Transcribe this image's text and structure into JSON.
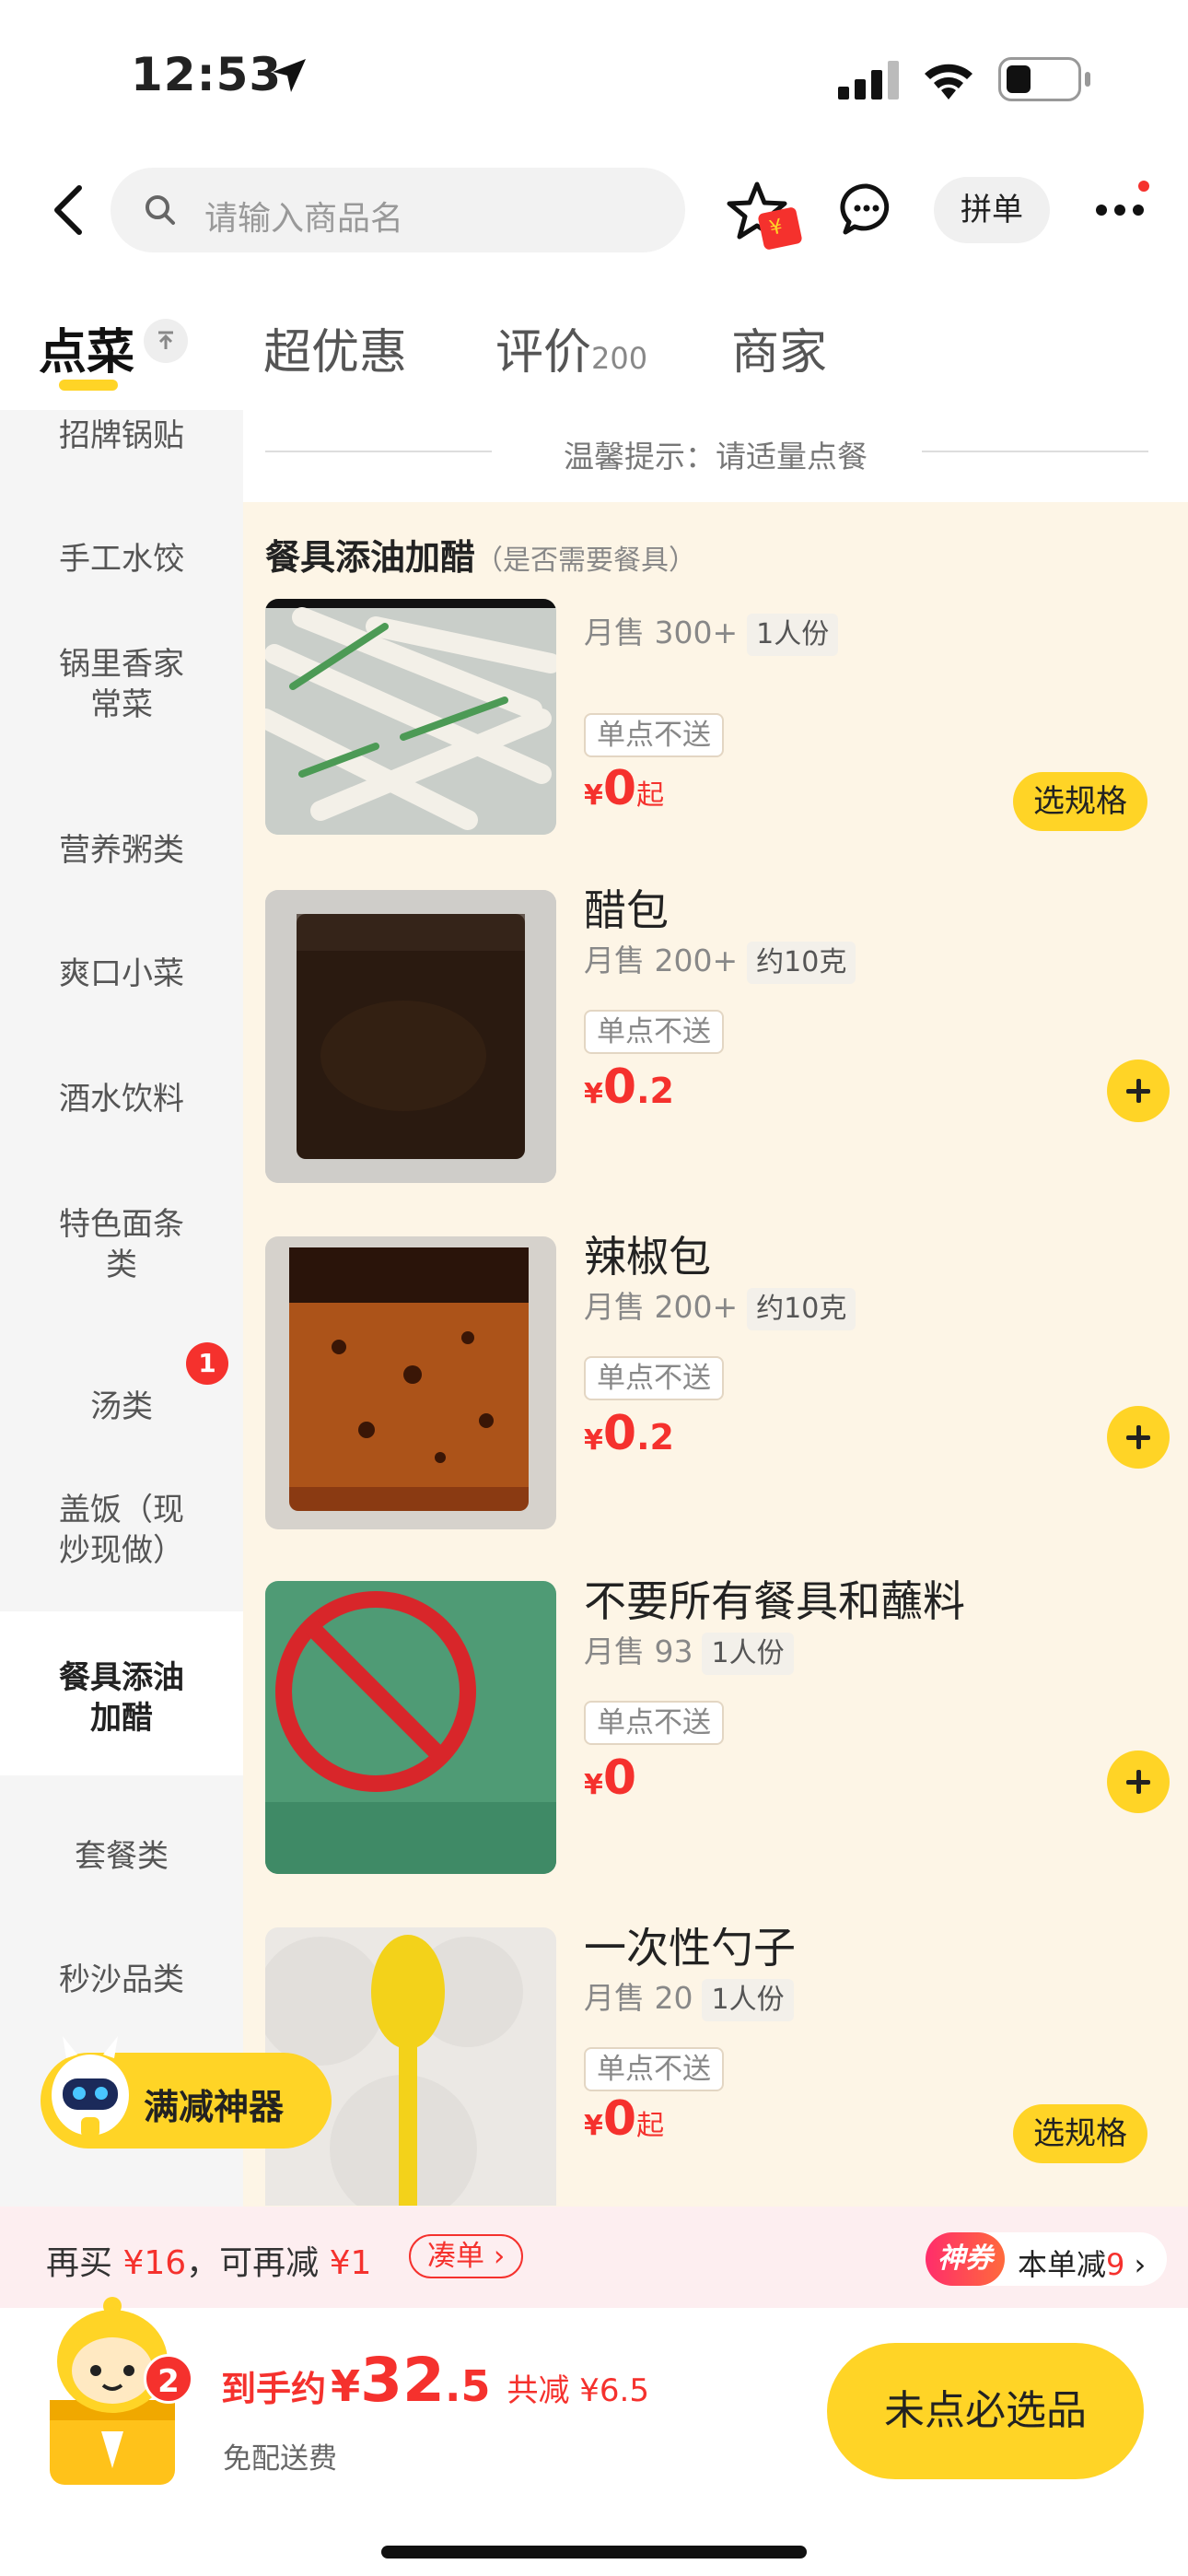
{
  "status": {
    "time": "12:53"
  },
  "nav": {
    "search_placeholder": "请输入商品名",
    "pindan_label": "拼单"
  },
  "tabs": [
    {
      "label": "点菜",
      "active": true
    },
    {
      "label": "超优惠"
    },
    {
      "label": "评价",
      "count": "200"
    },
    {
      "label": "商家"
    }
  ],
  "sidebar": {
    "items": [
      {
        "label": "招牌锅贴"
      },
      {
        "label": "手工水饺"
      },
      {
        "label": "锅里香家常菜"
      },
      {
        "label": "营养粥类"
      },
      {
        "label": "爽口小菜"
      },
      {
        "label": "酒水饮料"
      },
      {
        "label": "特色面条类"
      },
      {
        "label": "汤类",
        "badge": "1"
      },
      {
        "label": "盖饭（现炒现做）"
      },
      {
        "label": "餐具添油加醋",
        "active": true
      },
      {
        "label": "套餐类"
      },
      {
        "label": "秒沙品类"
      }
    ]
  },
  "notice": "温馨提示：请适量点餐",
  "section": {
    "title": "餐具添油加醋",
    "subtitle": "（是否需要餐具）"
  },
  "items": [
    {
      "name": "",
      "sales": "月售 300+",
      "tag": "1人份",
      "no_single": "单点不送",
      "price_yen": "¥",
      "price_int": "0",
      "price_dec": "",
      "price_suffix": "起",
      "action": "选规格"
    },
    {
      "name": "醋包",
      "sales": "月售 200+",
      "tag": "约10克",
      "no_single": "单点不送",
      "price_yen": "¥",
      "price_int": "0",
      "price_dec": ".2",
      "price_suffix": "",
      "action": "plus"
    },
    {
      "name": "辣椒包",
      "sales": "月售 200+",
      "tag": "约10克",
      "no_single": "单点不送",
      "price_yen": "¥",
      "price_int": "0",
      "price_dec": ".2",
      "price_suffix": "",
      "action": "plus"
    },
    {
      "name": "不要所有餐具和蘸料",
      "sales": "月售 93",
      "tag": "1人份",
      "no_single": "单点不送",
      "price_yen": "¥",
      "price_int": "0",
      "price_dec": "",
      "price_suffix": "",
      "action": "plus"
    },
    {
      "name": "一次性勺子",
      "sales": "月售 20",
      "tag": "1人份",
      "no_single": "单点不送",
      "price_yen": "¥",
      "price_int": "0",
      "price_dec": "",
      "price_suffix": "起",
      "action": "选规格"
    }
  ],
  "promo": {
    "label": "满减神器"
  },
  "strip": {
    "text_a": "再买 ",
    "amount_a": "¥16",
    "text_b": "，可再减 ",
    "amount_b": "¥1",
    "coudan": "凑单",
    "shenquan": "神券",
    "benjian": "本单减",
    "benjian_num": "9"
  },
  "bottom": {
    "cart_count": "2",
    "total_label": "到手约",
    "total_yen": "¥",
    "total_int": "32",
    "total_dec": ".5",
    "discount": "共减 ¥6.5",
    "free_ship": "免配送费",
    "checkout": "未点必选品"
  },
  "colors": {
    "accent": "#ffd426",
    "price": "#f5312d",
    "cream": "#fdf5e6"
  }
}
